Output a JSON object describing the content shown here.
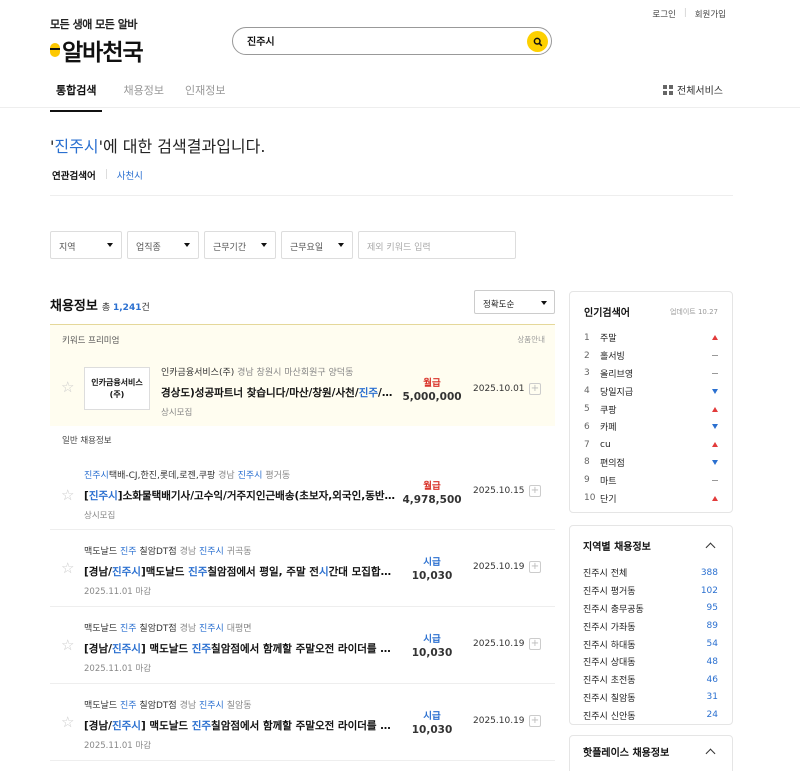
{
  "header": {
    "login": "로그인",
    "signup": "회원가입",
    "logo_tagline": "모든 생애 모든 알바",
    "logo_name": "알바천국",
    "search_value": "진주시",
    "tabs": [
      "통합검색",
      "채용정보",
      "인재정보"
    ],
    "all_services": "전체서비스"
  },
  "result": {
    "quote_open": "'",
    "keyword": "진주시",
    "title_rest": "'에 대한 검색결과입니다.",
    "related_label": "연관검색어",
    "related_items": [
      "사천시"
    ]
  },
  "filters": {
    "selects": [
      "지역",
      "업직종",
      "근무기간",
      "근무요일"
    ],
    "keyword_placeholder": "제외 키워드 입력"
  },
  "listing": {
    "heading": "채용정보",
    "count_prefix": "총",
    "count": "1,241",
    "count_suffix": "건",
    "sort": "정확도순",
    "premium_label": "키워드 프리미엄",
    "premium_guide": "상품안내",
    "general_label": "일반 채용정보",
    "premium_job": {
      "company_box": "인카금융서비스(주)",
      "company": "인카금융서비스(주)",
      "location": "경남 창원시 마산회원구 양덕동",
      "title_a": "경상도)성공파트너 찾습니다/마산/창원/사천/",
      "title_hl": "진주",
      "title_b": "/통...",
      "sub": "상시모집",
      "pay_type": "월급",
      "pay_amount": "5,000,000",
      "date": "2025.10.01"
    },
    "jobs": [
      {
        "co_hl": "진주시",
        "co_rest": "택배-CJ,한진,롯데,로젠,쿠팡",
        "loc_a": "경남",
        "loc_hl": "진주시",
        "loc_b": "평거동",
        "title_a": "[",
        "title_hl": "진주시",
        "title_b": "]소화물택배기사/고수익/거주지인근배송(초보자,외국인,동반 가...",
        "sub": "상시모집",
        "pay_type": "월급",
        "pay_kind": "monthly",
        "pay_amount": "4,978,500",
        "date": "2025.10.15"
      },
      {
        "co_a": "맥도날드 ",
        "co_hl": "진주",
        "co_rest": " 칠암DT점",
        "loc_a": "경남",
        "loc_hl": "진주시",
        "loc_b": "귀곡동",
        "title_a": "[경남/",
        "title_hl": "진주시",
        "title_b": "]맥도날드 ",
        "title_hl2": "진주",
        "title_c": "칠암점에서 평일, 주말 전",
        "title_hl3": "시",
        "title_d": "간대 모집합니다",
        "sub": "2025.11.01 마감",
        "pay_type": "시급",
        "pay_kind": "hourly",
        "pay_amount": "10,030",
        "date": "2025.10.19"
      },
      {
        "co_a": "맥도날드 ",
        "co_hl": "진주",
        "co_rest": " 칠암DT점",
        "loc_a": "경남",
        "loc_hl": "진주시",
        "loc_b": "대평면",
        "title_a": "[경남/",
        "title_hl": "진주시",
        "title_b": "] 맥도날드 ",
        "title_hl2": "진주",
        "title_c": "칠암점에서 함께할 주말오전 라이더를 모집...",
        "sub": "2025.11.01 마감",
        "pay_type": "시급",
        "pay_kind": "hourly",
        "pay_amount": "10,030",
        "date": "2025.10.19"
      },
      {
        "co_a": "맥도날드 ",
        "co_hl": "진주",
        "co_rest": " 칠암DT점",
        "loc_a": "경남",
        "loc_hl": "진주시",
        "loc_b": "칠암동",
        "title_a": "[경남/",
        "title_hl": "진주시",
        "title_b": "] 맥도날드 ",
        "title_hl2": "진주",
        "title_c": "칠암점에서 함께할 주말오전 라이더를 모집...",
        "sub": "2025.11.01 마감",
        "pay_type": "시급",
        "pay_kind": "hourly",
        "pay_amount": "10,030",
        "date": "2025.10.19"
      }
    ]
  },
  "sidebar": {
    "popular": {
      "title": "인기검색어",
      "updated": "업데이트 10.27",
      "items": [
        {
          "rank": "1",
          "name": "주말",
          "trend": "up"
        },
        {
          "rank": "2",
          "name": "홀서빙",
          "trend": "same"
        },
        {
          "rank": "3",
          "name": "올리브영",
          "trend": "same"
        },
        {
          "rank": "4",
          "name": "당일지급",
          "trend": "down"
        },
        {
          "rank": "5",
          "name": "쿠팡",
          "trend": "up"
        },
        {
          "rank": "6",
          "name": "카페",
          "trend": "down"
        },
        {
          "rank": "7",
          "name": "cu",
          "trend": "up"
        },
        {
          "rank": "8",
          "name": "편의점",
          "trend": "down"
        },
        {
          "rank": "9",
          "name": "마트",
          "trend": "same"
        },
        {
          "rank": "10",
          "name": "단기",
          "trend": "up"
        }
      ]
    },
    "regional": {
      "title": "지역별 채용정보",
      "items": [
        {
          "name": "진주시 전체",
          "count": "388"
        },
        {
          "name": "진주시 평거동",
          "count": "102"
        },
        {
          "name": "진주시 충무공동",
          "count": "95"
        },
        {
          "name": "진주시 가좌동",
          "count": "89"
        },
        {
          "name": "진주시 하대동",
          "count": "54"
        },
        {
          "name": "진주시 상대동",
          "count": "48"
        },
        {
          "name": "진주시 초전동",
          "count": "46"
        },
        {
          "name": "진주시 칠암동",
          "count": "31"
        },
        {
          "name": "진주시 신안동",
          "count": "24"
        }
      ]
    },
    "hotplace": {
      "title": "핫플레이스 채용정보"
    },
    "colors": {
      "accent_blue": "#2b70d0",
      "brand_yellow": "#fdd000",
      "monthly_red": "#d9342b"
    }
  }
}
